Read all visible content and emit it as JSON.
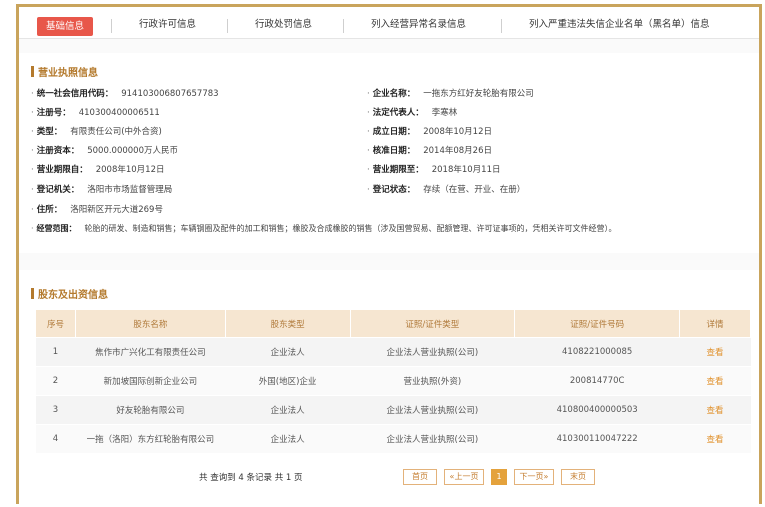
{
  "tabs": [
    {
      "label": "基础信息",
      "active": true
    },
    {
      "label": "行政许可信息"
    },
    {
      "label": "行政处罚信息"
    },
    {
      "label": "列入经营异常名录信息"
    },
    {
      "label": "列入严重违法失信企业名单（黑名单）信息"
    }
  ],
  "license": {
    "title": "营业执照信息",
    "fields": [
      {
        "label": "统一社会信用代码：",
        "value": "914103006807657783"
      },
      {
        "label": "企业名称：",
        "value": "一拖东方红好友轮胎有限公司"
      },
      {
        "label": "注册号：",
        "value": "410300400006511"
      },
      {
        "label": "法定代表人：",
        "value": "李寒林"
      },
      {
        "label": "类型：",
        "value": "有限责任公司(中外合资)"
      },
      {
        "label": "成立日期：",
        "value": "2008年10月12日"
      },
      {
        "label": "注册资本：",
        "value": "5000.000000万人民币"
      },
      {
        "label": "核准日期：",
        "value": "2014年08月26日"
      },
      {
        "label": "营业期限自：",
        "value": "2008年10月12日"
      },
      {
        "label": "营业期限至：",
        "value": "2018年10月11日"
      },
      {
        "label": "登记机关：",
        "value": "洛阳市市场监督管理局"
      },
      {
        "label": "登记状态：",
        "value": "存续（在营、开业、在册）"
      },
      {
        "label": "住所：",
        "value": "洛阳新区开元大道269号"
      },
      {
        "label": "经营范围：",
        "value": "轮胎的研发、制造和销售；车辆钢圈及配件的加工和销售；橡胶及合成橡胶的销售（涉及国营贸易、配额管理、许可证事项的，凭相关许可文件经营）。"
      }
    ]
  },
  "shareholders": {
    "title": "股东及出资信息",
    "columns": [
      "序号",
      "股东名称",
      "股东类型",
      "证照/证件类型",
      "证照/证件号码",
      "详情"
    ],
    "rows": [
      {
        "no": "1",
        "name": "焦作市广兴化工有限责任公司",
        "type": "企业法人",
        "cert_type": "企业法人营业执照(公司)",
        "cert_no": "4108221000085",
        "detail": "查看"
      },
      {
        "no": "2",
        "name": "新加坡国际创新企业公司",
        "type": "外国(地区)企业",
        "cert_type": "营业执照(外资)",
        "cert_no": "200814770C",
        "detail": "查看"
      },
      {
        "no": "3",
        "name": "好友轮胎有限公司",
        "type": "企业法人",
        "cert_type": "企业法人营业执照(公司)",
        "cert_no": "410800400000503",
        "detail": "查看"
      },
      {
        "no": "4",
        "name": "一拖（洛阳）东方红轮胎有限公司",
        "type": "企业法人",
        "cert_type": "企业法人营业执照(公司)",
        "cert_no": "410300110047222",
        "detail": "查看"
      }
    ]
  },
  "pager": {
    "summary": "共 查询到 4 条记录 共 1 页",
    "first": "首页",
    "prev": "«上一页",
    "current": "1",
    "next": "下一页»",
    "last": "末页"
  },
  "colors": {
    "accent": "#e8574a",
    "brand": "#b47a2d",
    "border": "#c9a45c"
  }
}
